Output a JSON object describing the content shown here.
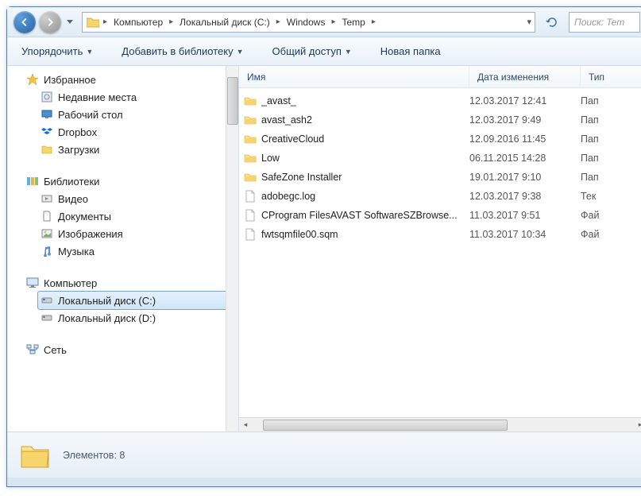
{
  "breadcrumb": {
    "segments": [
      "Компьютер",
      "Локальный диск (C:)",
      "Windows",
      "Temp"
    ]
  },
  "search": {
    "placeholder": "Поиск: Tem"
  },
  "toolbar": {
    "organize": "Упорядочить",
    "include": "Добавить в библиотеку",
    "share": "Общий доступ",
    "newfolder": "Новая папка"
  },
  "sidebar": {
    "favorites": {
      "head": "Избранное",
      "items": [
        {
          "label": "Недавние места",
          "icon": "recent"
        },
        {
          "label": "Рабочий стол",
          "icon": "desktop"
        },
        {
          "label": "Dropbox",
          "icon": "dropbox"
        },
        {
          "label": "Загрузки",
          "icon": "downloads"
        }
      ]
    },
    "libraries": {
      "head": "Библиотеки",
      "items": [
        {
          "label": "Видео",
          "icon": "video"
        },
        {
          "label": "Документы",
          "icon": "document"
        },
        {
          "label": "Изображения",
          "icon": "image"
        },
        {
          "label": "Музыка",
          "icon": "music"
        }
      ]
    },
    "computer": {
      "head": "Компьютер",
      "items": [
        {
          "label": "Локальный диск (C:)",
          "icon": "disk",
          "selected": true
        },
        {
          "label": "Локальный диск (D:)",
          "icon": "disk"
        }
      ]
    },
    "network": {
      "head": "Сеть"
    }
  },
  "columns": {
    "name": "Имя",
    "date": "Дата изменения",
    "type": "Тип"
  },
  "files": [
    {
      "name": "_avast_",
      "date": "12.03.2017 12:41",
      "type": "Пап",
      "icon": "folder"
    },
    {
      "name": "avast_ash2",
      "date": "12.03.2017 9:49",
      "type": "Пап",
      "icon": "folder"
    },
    {
      "name": "CreativeCloud",
      "date": "12.09.2016 11:45",
      "type": "Пап",
      "icon": "folder"
    },
    {
      "name": "Low",
      "date": "06.11.2015 14:28",
      "type": "Пап",
      "icon": "folder"
    },
    {
      "name": "SafeZone Installer",
      "date": "19.01.2017 9:10",
      "type": "Пап",
      "icon": "folder"
    },
    {
      "name": "adobegc.log",
      "date": "12.03.2017 9:38",
      "type": "Тек",
      "icon": "file"
    },
    {
      "name": "CProgram FilesAVAST SoftwareSZBrowse...",
      "date": "11.03.2017 9:51",
      "type": "Фай",
      "icon": "file"
    },
    {
      "name": "fwtsqmfile00.sqm",
      "date": "11.03.2017 10:34",
      "type": "Фай",
      "icon": "file"
    }
  ],
  "status": {
    "label": "Элементов:",
    "count": "8"
  }
}
